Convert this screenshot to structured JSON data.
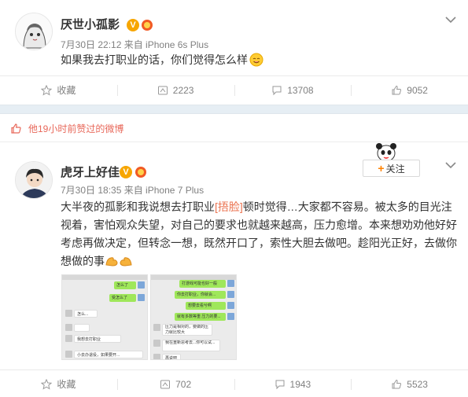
{
  "post1": {
    "author": "厌世小孤影",
    "meta": "7月30日 22:12 来自 iPhone 6s Plus",
    "text": "如果我去打职业的话，你们觉得怎么样",
    "actions": {
      "fav": "收藏",
      "repost": "2223",
      "comment": "13708",
      "like": "9052"
    }
  },
  "liked_notice": "他19小时前赞过的微博",
  "post2": {
    "author": "虎牙上好佳",
    "meta": "7月30日 18:35 来自 iPhone 7 Plus",
    "follow": "关注",
    "text_part1": "大半夜的孤影和我说想去打职业",
    "text_hl": "[捂脸]",
    "text_part2": "顿时觉得…大家都不容易。被太多的目光注视着，害怕观众失望，对自己的要求也就越来越高，压力愈增。本来想劝劝他好好考虑再做决定，但转念一想，既然开口了，索性大胆去做吧。趁阳光正好，去做你想做的事",
    "actions": {
      "fav": "收藏",
      "repost": "702",
      "comment": "1943",
      "like": "5523"
    },
    "chat1": [
      "怎么了",
      "受怎么了",
      "怎么...",
      "我想去打职业",
      "小去办退役，如果要开..."
    ],
    "chat2": [
      "打游戏可能也好一般",
      "你去打职业，你就会...",
      "想要去看兮啊",
      "就有多数等重 压力的要...",
      "压力是相对的，要做的压力就比较大",
      "我在重新思考去...你可以试...",
      "再说吧"
    ]
  },
  "colors": {
    "accent": "#ff8200",
    "liked": "#e8685a",
    "link": "#eb7350",
    "vip": "#f7a600"
  }
}
